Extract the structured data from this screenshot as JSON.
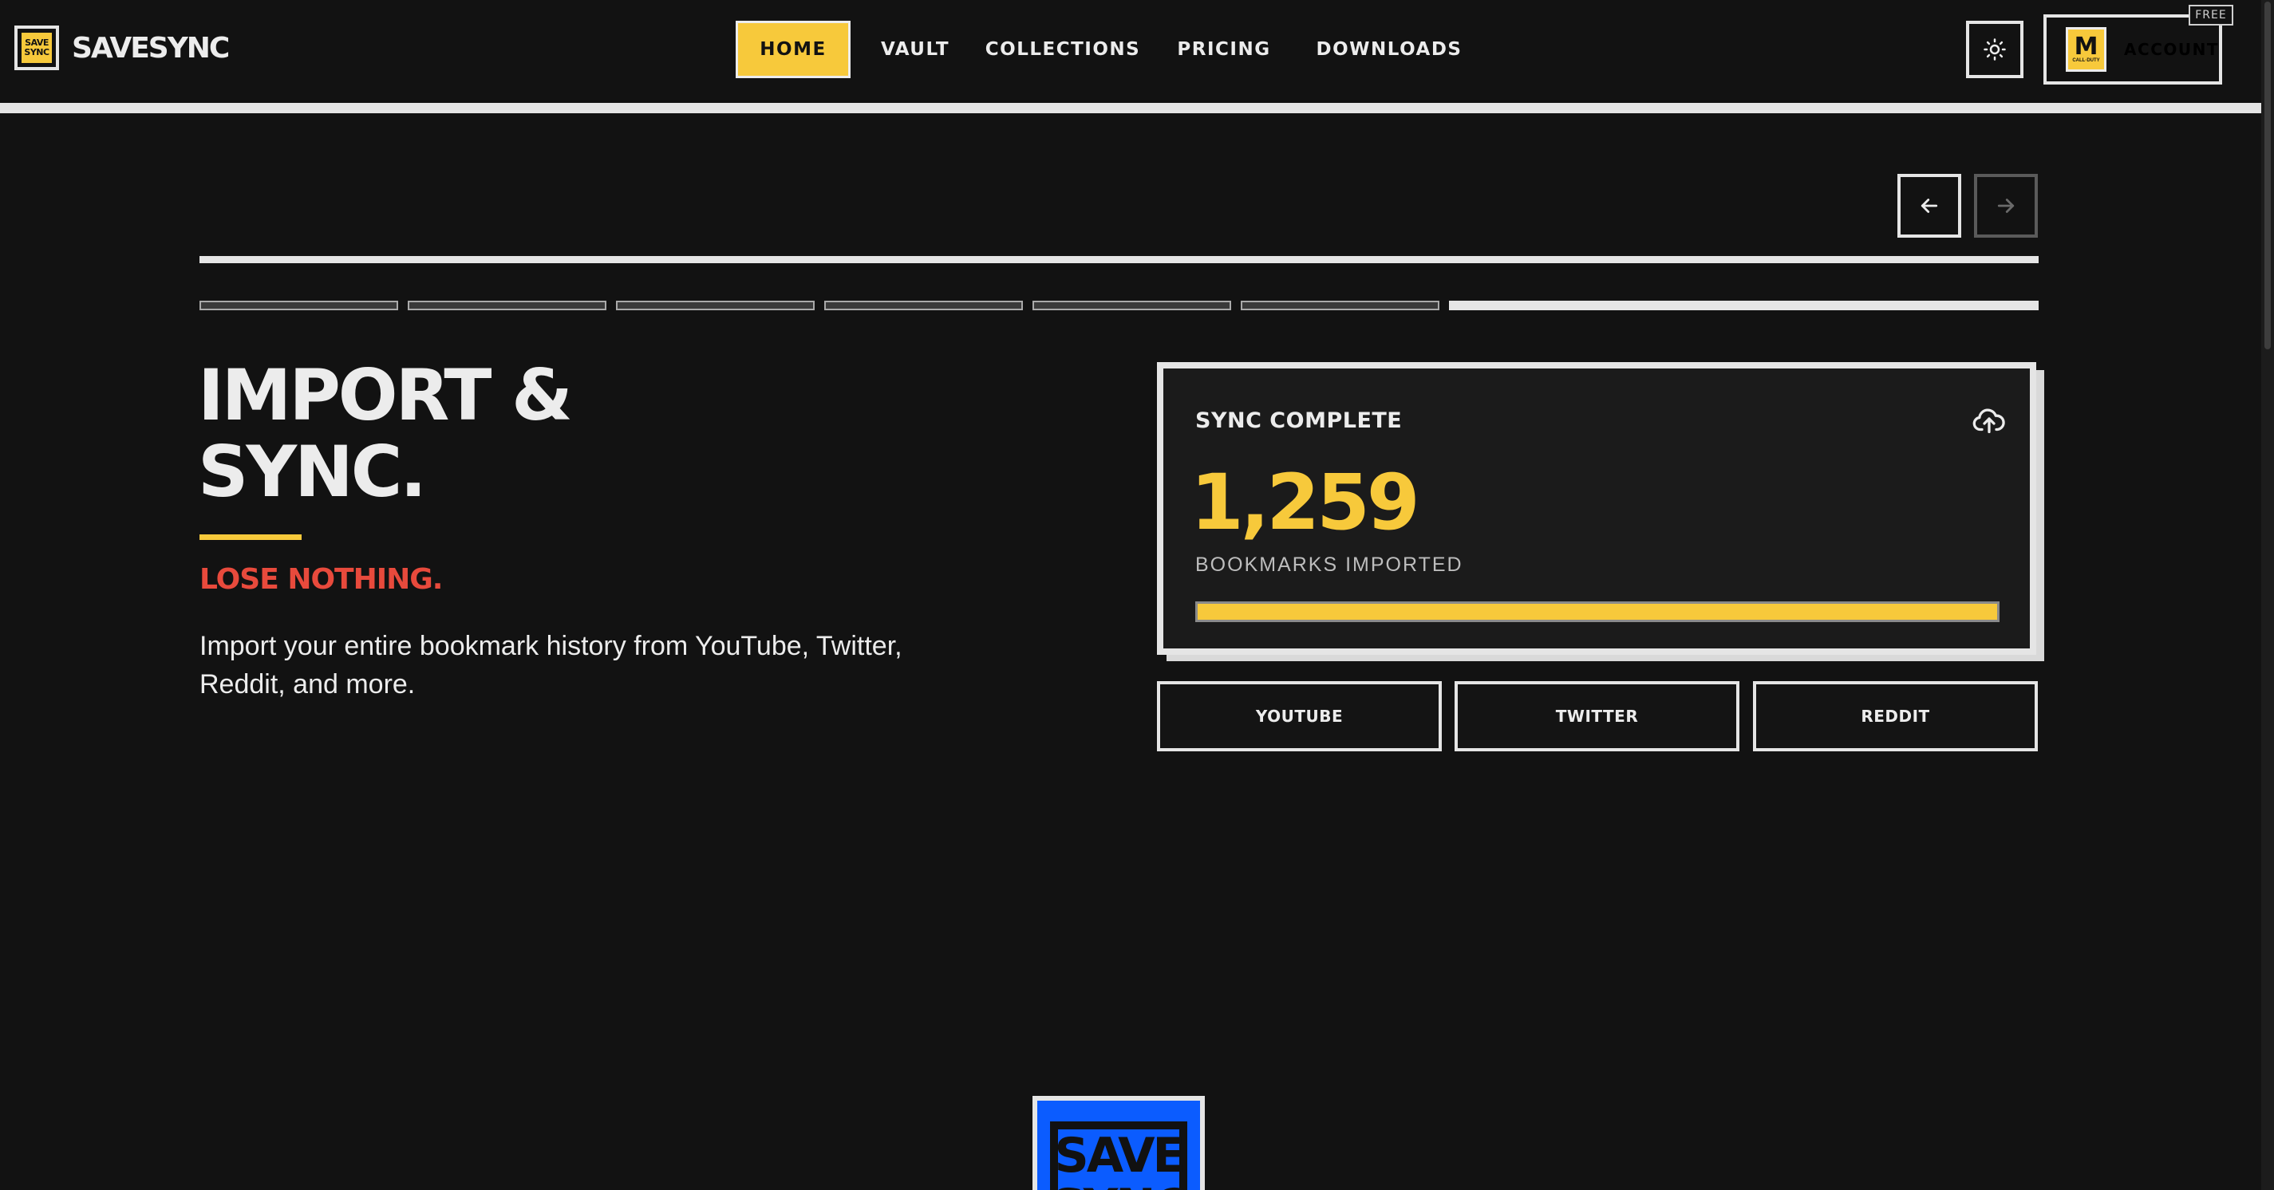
{
  "header": {
    "brand_name": "SAVESYNC",
    "brand_logo_line1": "SAVE",
    "brand_logo_line2": "SYNC",
    "nav": [
      {
        "label": "HOME",
        "active": true
      },
      {
        "label": "VAULT",
        "active": false
      },
      {
        "label": "COLLECTIONS",
        "active": false
      },
      {
        "label": "PRICING",
        "active": false
      },
      {
        "label": "DOWNLOADS",
        "active": false
      }
    ],
    "theme_toggle_icon": "sun-icon",
    "account": {
      "label": "ACCOUNT",
      "badge": "FREE",
      "avatar_letter": "M",
      "avatar_caption": "CALL·DUTY"
    }
  },
  "slider": {
    "prev_icon": "arrow-left-icon",
    "next_icon": "arrow-right-icon",
    "segments_total": 7,
    "active_segment": 7
  },
  "hero": {
    "headline": "IMPORT &\nSYNC.",
    "tagline": "LOSE NOTHING.",
    "description": "Import your entire bookmark history from YouTube, Twitter, Reddit, and more."
  },
  "sync_card": {
    "title": "SYNC COMPLETE",
    "icon": "cloud-upload-icon",
    "count": "1,259",
    "count_label": "BOOKMARKS IMPORTED",
    "progress": 1.0
  },
  "sources": [
    {
      "label": "YOUTUBE"
    },
    {
      "label": "TWITTER"
    },
    {
      "label": "REDDIT"
    }
  ],
  "footer_logo": {
    "line1": "SAVE",
    "line2": "SYNC"
  },
  "colors": {
    "background": "#121212",
    "accent_yellow": "#f7c93b",
    "accent_red": "#e84a3c",
    "border_light": "#e5e5e5",
    "footer_blue": "#0b5cff"
  }
}
